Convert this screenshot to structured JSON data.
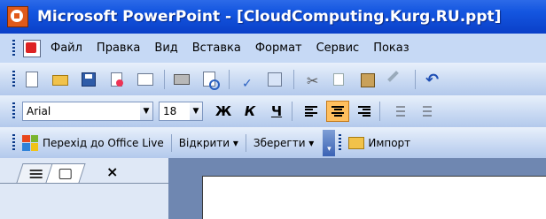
{
  "window": {
    "title": "Microsoft PowerPoint - [CloudComputing.Kurg.RU.ppt]"
  },
  "menubar": {
    "items": [
      "Файл",
      "Правка",
      "Вид",
      "Вставка",
      "Формат",
      "Сервис",
      "Показ"
    ]
  },
  "standard_toolbar": {
    "icons": [
      "new-icon",
      "open-icon",
      "save-icon",
      "permission-icon",
      "email-icon",
      "print-icon",
      "print-preview-icon",
      "spelling-icon",
      "research-icon",
      "cut-icon",
      "copy-icon",
      "paste-icon",
      "format-painter-icon",
      "undo-icon"
    ]
  },
  "formatting_toolbar": {
    "font_name": "Arial",
    "font_size": "18",
    "bold_label": "Ж",
    "italic_label": "К",
    "underline_label": "Ч",
    "active_alignment": "center"
  },
  "office_live_toolbar": {
    "go_to_office_live": "Перехід до Office Live",
    "open_label": "Відкрити ▾",
    "save_label": "Зберегти ▾",
    "import_label": "Импорт"
  },
  "pane": {
    "close_label": "×"
  },
  "colors": {
    "titlebar": "#0a3fc8",
    "menubar": "#c6d9f5",
    "active_button": "#ffbf5e",
    "workspace": "#6f87b1"
  }
}
